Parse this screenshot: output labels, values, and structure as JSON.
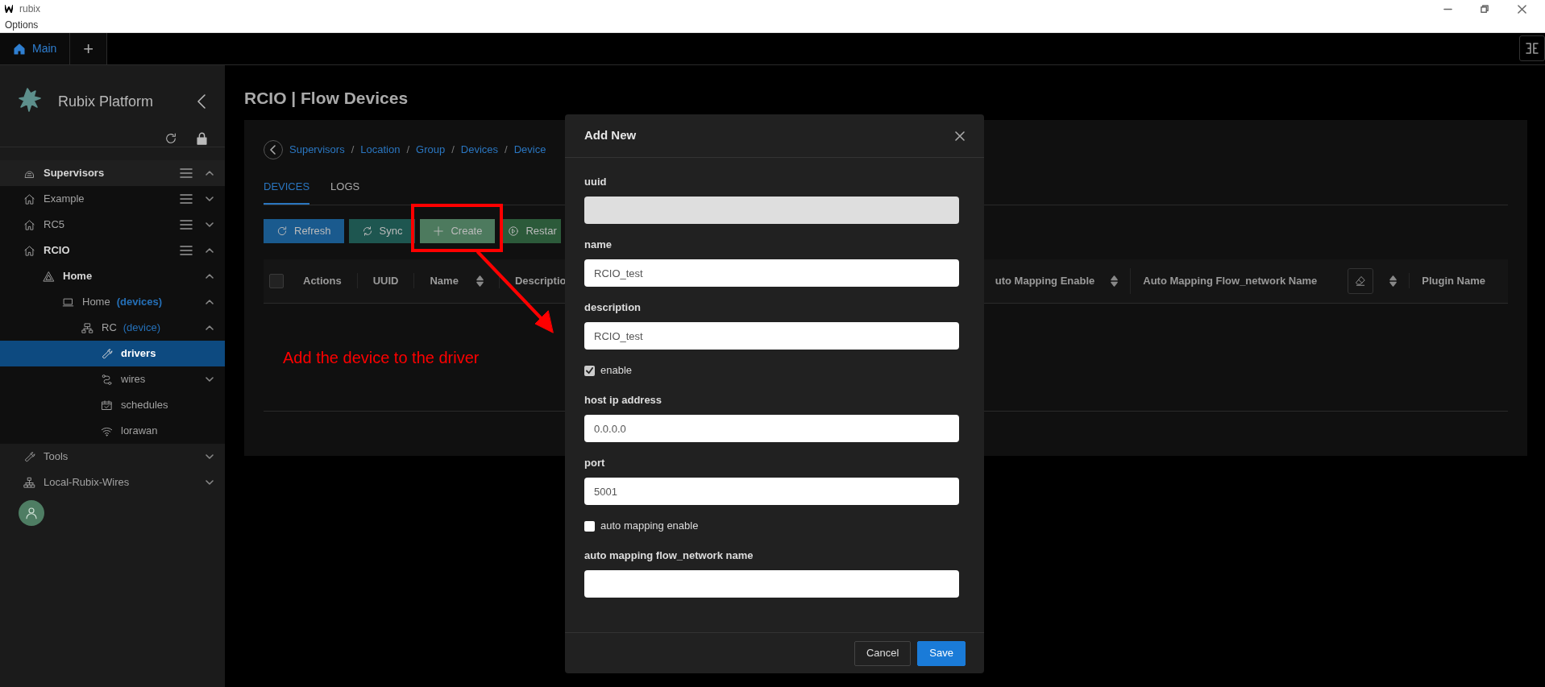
{
  "window": {
    "title": "rubix",
    "menu": [
      "Options"
    ]
  },
  "app_tabs": [
    {
      "label": "Main",
      "kind": "home",
      "selected": true
    },
    {
      "label": "+",
      "kind": "add",
      "selected": false
    }
  ],
  "sidebar": {
    "title": "Rubix Platform",
    "tree": [
      {
        "label": "Supervisors",
        "kind": "supervisors",
        "active": true,
        "selected": false,
        "menu": true,
        "expanded": true,
        "children": [
          {
            "label": "Example",
            "kind": "location",
            "active": false,
            "selected": false,
            "menu": true,
            "expanded": false
          },
          {
            "label": "RC5",
            "kind": "location",
            "active": false,
            "selected": false,
            "menu": true,
            "expanded": false
          },
          {
            "label": "RCIO",
            "kind": "location",
            "active": true,
            "selected": false,
            "menu": true,
            "expanded": true,
            "children": [
              {
                "label": "Home",
                "kind": "group",
                "active": true,
                "selected": false,
                "expanded": true,
                "children": [
                  {
                    "label": "Home",
                    "suffix": "(devices)",
                    "suffix_bold": true,
                    "kind": "devices",
                    "active": false,
                    "selected": false,
                    "expanded": true,
                    "children": [
                      {
                        "label": "RC",
                        "suffix": "(device)",
                        "suffix_bold": false,
                        "kind": "device",
                        "active": false,
                        "selected": false,
                        "expanded": true,
                        "children": [
                          {
                            "label": "drivers",
                            "kind": "driver",
                            "active": true,
                            "selected": true
                          },
                          {
                            "label": "wires",
                            "kind": "wires",
                            "active": false,
                            "selected": false,
                            "expanded": false
                          },
                          {
                            "label": "schedules",
                            "kind": "schedules",
                            "active": false,
                            "selected": false
                          },
                          {
                            "label": "lorawan",
                            "kind": "network",
                            "active": false,
                            "selected": false
                          }
                        ]
                      }
                    ]
                  }
                ]
              }
            ]
          }
        ]
      },
      {
        "label": "Tools",
        "kind": "tools",
        "active": false,
        "selected": false,
        "expanded": false
      },
      {
        "label": "Local-Rubix-Wires",
        "kind": "hierarchy",
        "active": false,
        "selected": false,
        "expanded": false
      }
    ]
  },
  "page": {
    "title": "RCIO | Flow Devices",
    "breadcrumb": [
      {
        "kind": "link",
        "text": "Supervisors"
      },
      {
        "kind": "separator",
        "text": "/"
      },
      {
        "kind": "link",
        "text": "Location"
      },
      {
        "kind": "separator",
        "text": "/"
      },
      {
        "kind": "link",
        "text": "Group"
      },
      {
        "kind": "separator",
        "text": "/"
      },
      {
        "kind": "link",
        "text": "Devices"
      },
      {
        "kind": "separator",
        "text": "/"
      },
      {
        "kind": "link",
        "text": "Device"
      }
    ],
    "tabs": [
      {
        "label": "DEVICES",
        "selected": true
      },
      {
        "label": "LOGS",
        "selected": false
      }
    ],
    "toolbar": [
      {
        "label": "Refresh",
        "kind": "refresh"
      },
      {
        "label": "Sync",
        "kind": "sync"
      },
      {
        "label": "Create",
        "kind": "create"
      },
      {
        "label": "Restar",
        "kind": "restart"
      }
    ],
    "select_all": {
      "checked": false
    },
    "columns_left": [
      {
        "label": "Actions"
      },
      {
        "label": "UUID"
      },
      {
        "label": "Name",
        "sortable": true
      },
      {
        "label": "Descriptio"
      }
    ],
    "columns_right": [
      {
        "label": "uto Mapping Enable",
        "sortable": true
      },
      {
        "label": "Auto Mapping Flow_network Name",
        "filter": true,
        "sortable": true
      },
      {
        "label": "Plugin Name"
      }
    ]
  },
  "dialog": {
    "title": "Add New",
    "fields": [
      {
        "kind": "text",
        "label": "uuid",
        "disabled": true
      },
      {
        "kind": "text",
        "label": "name",
        "value": "RCIO_test",
        "disabled": false
      },
      {
        "kind": "text",
        "label": "description",
        "value": "RCIO_test",
        "disabled": false
      },
      {
        "kind": "checkbox",
        "label": "enable",
        "checked": true
      },
      {
        "kind": "text",
        "label": "host ip address",
        "value": "0.0.0.0",
        "disabled": false
      },
      {
        "kind": "text",
        "label": "port",
        "value": "5001",
        "disabled": false
      },
      {
        "kind": "checkbox",
        "label": "auto mapping enable",
        "checked": false
      },
      {
        "kind": "text",
        "label": "auto mapping flow_network name",
        "disabled": false
      }
    ],
    "buttons": [
      {
        "label": "Cancel",
        "kind": "secondary"
      },
      {
        "label": "Save",
        "kind": "primary"
      }
    ]
  },
  "annotation": {
    "text": "Add the device to the driver"
  }
}
